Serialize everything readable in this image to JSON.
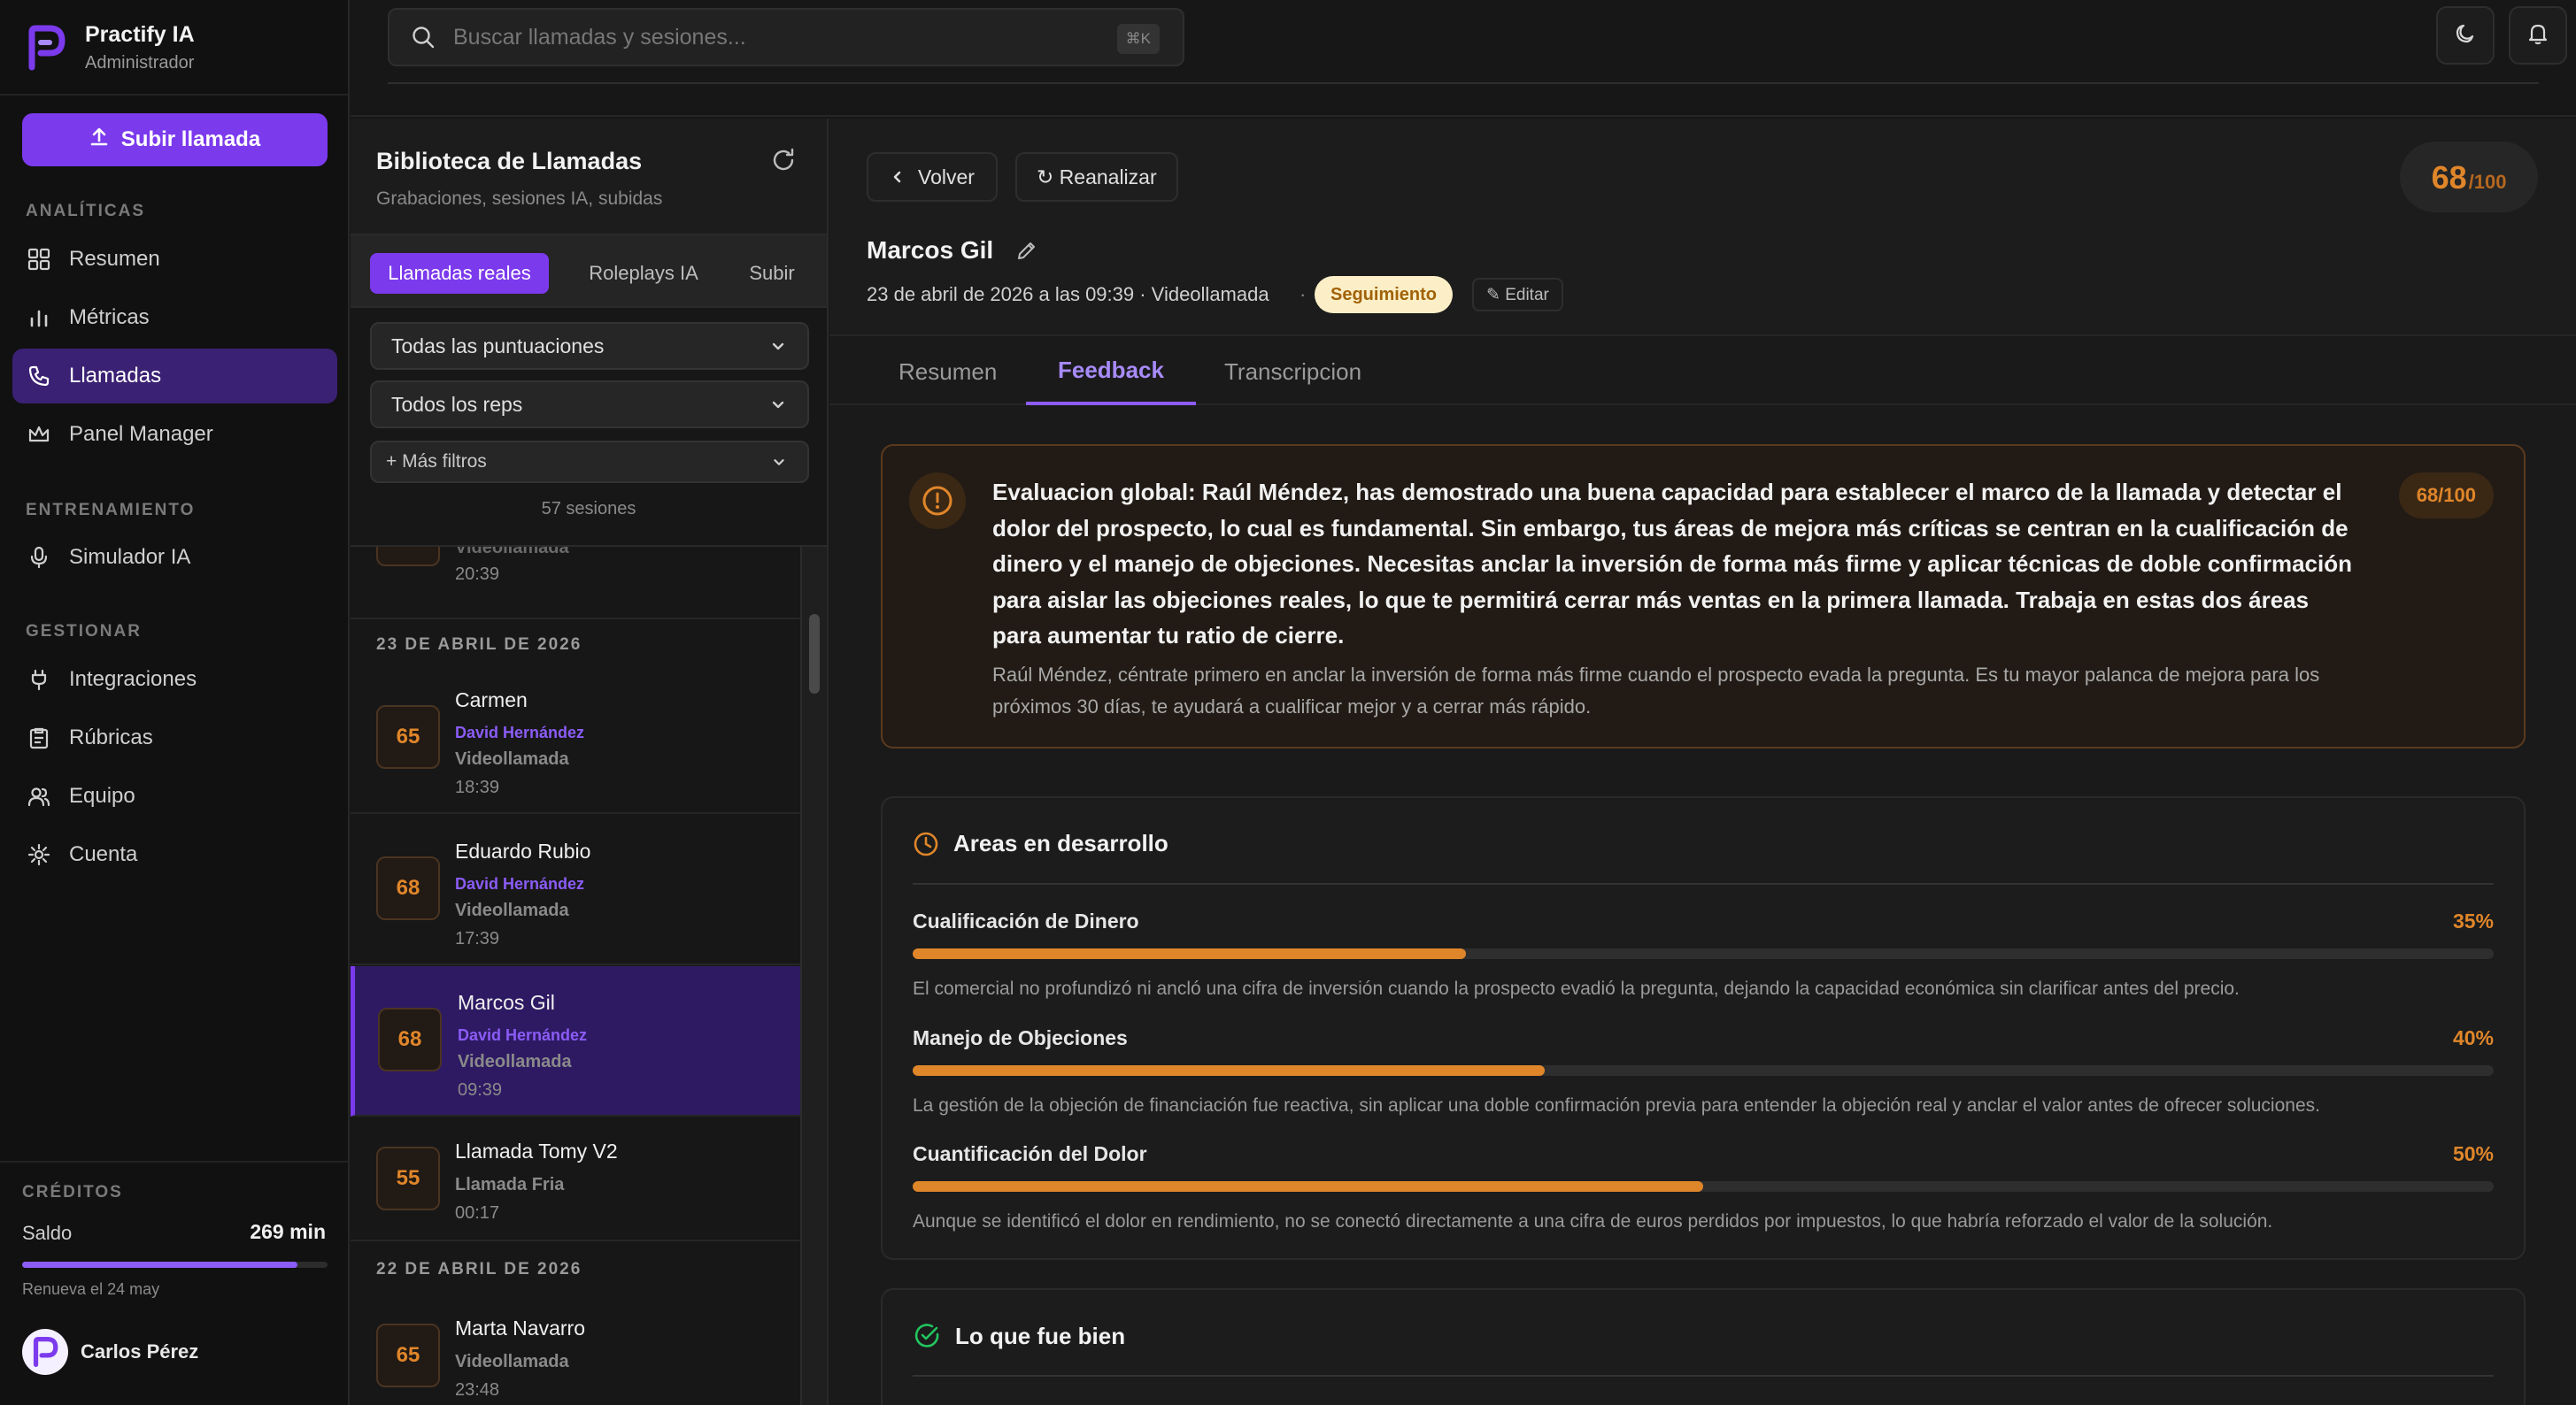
{
  "brand": {
    "name": "Practify IA",
    "role": "Administrador"
  },
  "sidebar": {
    "upload_label": "Subir llamada",
    "sections": {
      "analytics": "ANALÍTICAS",
      "training": "ENTRENAMIENTO",
      "manage": "GESTIONAR"
    },
    "items": [
      {
        "label": "Resumen",
        "icon": "grid-icon"
      },
      {
        "label": "Métricas",
        "icon": "bar-chart-icon"
      },
      {
        "label": "Llamadas",
        "icon": "phone-icon",
        "active": true
      },
      {
        "label": "Panel Manager",
        "icon": "crown-icon"
      },
      {
        "label": "Simulador IA",
        "icon": "microphone-icon"
      },
      {
        "label": "Integraciones",
        "icon": "plug-icon"
      },
      {
        "label": "Rúbricas",
        "icon": "clipboard-icon"
      },
      {
        "label": "Equipo",
        "icon": "users-icon"
      },
      {
        "label": "Cuenta",
        "icon": "gear-icon"
      }
    ],
    "credits": {
      "label": "CRÉDITOS",
      "saldo_label": "Saldo",
      "saldo_value": "269 min",
      "fill_fraction": 0.9,
      "renew": "Renueva el 24 may"
    },
    "user": "Carlos Pérez"
  },
  "topbar": {
    "search_placeholder": "Buscar llamadas y sesiones...",
    "shortcut": "⌘K"
  },
  "library": {
    "title": "Biblioteca de Llamadas",
    "subtitle": "Grabaciones, sesiones IA, subidas",
    "tabs": [
      "Llamadas reales",
      "Roleplays IA",
      "Subir"
    ],
    "filter_scores": "Todas las puntuaciones",
    "filter_reps": "Todos los reps",
    "more_filters": "+ Más filtros",
    "sessions": "57 sesiones",
    "partial_row": {
      "type": "Videollamada",
      "time": "20:39"
    },
    "date1": "23 DE ABRIL DE 2026",
    "date2": "22 DE ABRIL DE 2026",
    "rows": [
      {
        "score": "65",
        "name": "Carmen",
        "rep": "David Hernández",
        "type": "Videollamada",
        "time": "18:39"
      },
      {
        "score": "68",
        "name": "Eduardo Rubio",
        "rep": "David Hernández",
        "type": "Videollamada",
        "time": "17:39"
      },
      {
        "score": "68",
        "name": "Marcos Gil",
        "rep": "David Hernández",
        "type": "Videollamada",
        "time": "09:39"
      },
      {
        "score": "55",
        "name": "Llamada Tomy V2",
        "rep": "",
        "type": "Llamada Fria",
        "time": "00:17"
      },
      {
        "score": "65",
        "name": "Marta Navarro",
        "rep": "",
        "type": "Videollamada",
        "time": "23:48"
      }
    ]
  },
  "detail": {
    "back_label": "Volver",
    "reanalyze_label": "↻ Reanalizar",
    "score": "68",
    "score_denom": "/100",
    "name": "Marcos Gil",
    "meta": "23 de abril de 2026 a las 09:39 · Videollamada",
    "meta_dot": "·",
    "badge": "Seguimiento",
    "edit_label": "✎ Editar",
    "tabs": [
      "Resumen",
      "Feedback",
      "Transcripcion"
    ],
    "overall_title": "Evaluacion global: Raúl Méndez, has demostrado una buena capacidad para establecer el marco de la llamada y detectar el dolor del prospecto, lo cual es fundamental. Sin embargo, tus áreas de mejora más críticas se centran en la cualificación de dinero y el manejo de objeciones. Necesitas anclar la inversión de forma más firme y aplicar técnicas de doble confirmación para aislar las objeciones reales, lo que te permitirá cerrar más ventas en la primera llamada. Trabaja en estas dos áreas para aumentar tu ratio de cierre.",
    "overall_sub": "Raúl Méndez, céntrate primero en anclar la inversión de forma más firme cuando el prospecto evada la pregunta. Es tu mayor palanca de mejora para los próximos 30 días, te ayudará a cualificar mejor y a cerrar más rápido.",
    "overall_score": "68/100",
    "areas_title": "Areas en desarrollo",
    "areas": [
      {
        "name": "Cualificación de Dinero",
        "pct": "35%",
        "value": 0.35,
        "desc": "El comercial no profundizó ni ancló una cifra de inversión cuando la prospecto evadió la pregunta, dejando la capacidad económica sin clarificar antes del precio."
      },
      {
        "name": "Manejo de Objeciones",
        "pct": "40%",
        "value": 0.4,
        "desc": "La gestión de la objeción de financiación fue reactiva, sin aplicar una doble confirmación previa para entender la objeción real y anclar el valor antes de ofrecer soluciones."
      },
      {
        "name": "Cuantificación del Dolor",
        "pct": "50%",
        "value": 0.5,
        "desc": "Aunque se identificó el dolor en rendimiento, no se conectó directamente a una cifra de euros perdidos por impuestos, lo que habría reforzado el valor de la solución."
      }
    ],
    "good_title": "Lo que fue bien"
  },
  "colors": {
    "accent": "#7c3aed",
    "score": "#e0862a",
    "badge_bg": "#fcefc7"
  }
}
